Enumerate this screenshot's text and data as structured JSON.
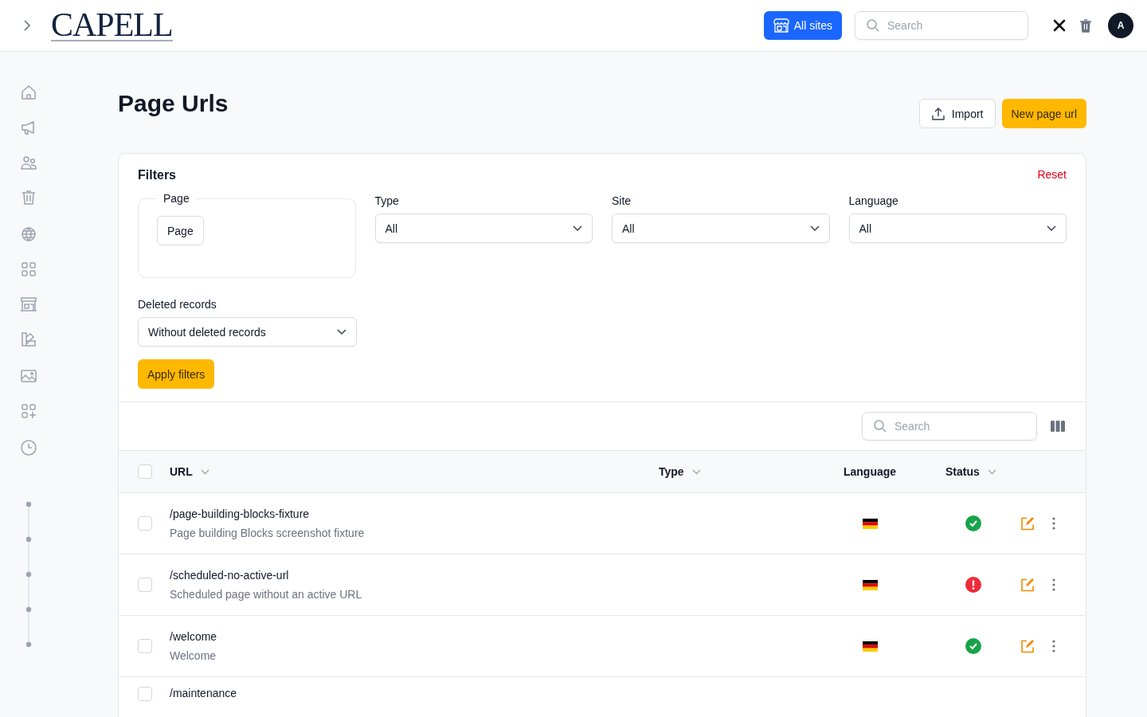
{
  "header": {
    "logo": "CAPELL",
    "site_button": "All sites",
    "search": {
      "placeholder": "Search"
    },
    "avatar": "A"
  },
  "page": {
    "title": "Page Urls",
    "import_button": "Import",
    "new_button": "New page url"
  },
  "filters": {
    "title": "Filters",
    "reset": "Reset",
    "page_group": {
      "legend": "Page",
      "button": "Page"
    },
    "selects": [
      {
        "label": "Type",
        "value": "All"
      },
      {
        "label": "Site",
        "value": "All"
      },
      {
        "label": "Language",
        "value": "All"
      }
    ],
    "deleted": {
      "label": "Deleted records",
      "value": "Without deleted records"
    },
    "apply": "Apply filters"
  },
  "table": {
    "search": {
      "placeholder": "Search"
    },
    "columns": [
      {
        "label": "URL",
        "sortable": true
      },
      {
        "label": "Type",
        "sortable": true
      },
      {
        "label": "Language",
        "sortable": false
      },
      {
        "label": "Status",
        "sortable": true
      }
    ],
    "select_all_checked": false,
    "rows": [
      {
        "url": "/page-building-blocks-fixture",
        "title": "Page building Blocks screenshot fixture",
        "kind": "ok",
        "checked": false
      },
      {
        "url": "/scheduled-no-active-url",
        "title": "Scheduled page without an active URL",
        "kind": "error",
        "checked": false
      },
      {
        "url": "/welcome",
        "title": "Welcome",
        "kind": "ok",
        "checked": false
      },
      {
        "url": "/maintenance",
        "checked": false
      }
    ]
  }
}
